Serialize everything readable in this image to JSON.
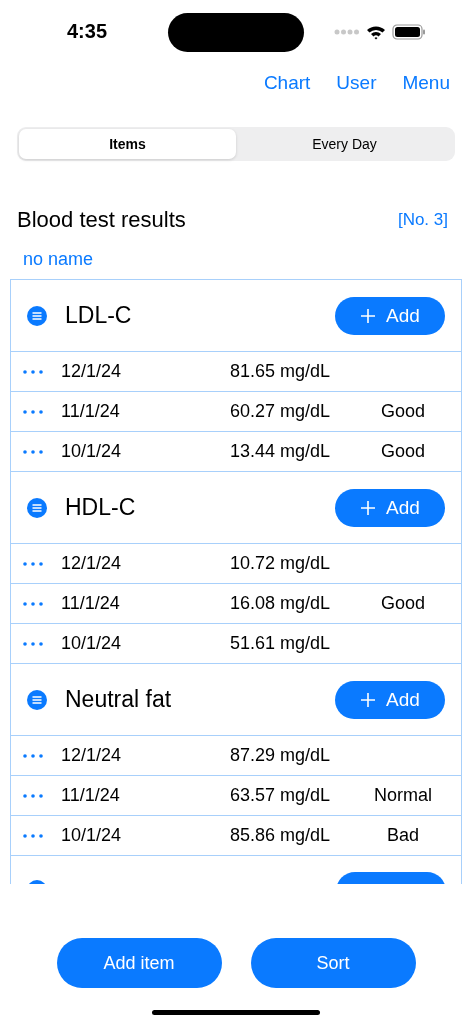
{
  "status_bar": {
    "time": "4:35"
  },
  "nav": [
    "Chart",
    "User",
    "Menu"
  ],
  "tabs": [
    {
      "label": "Items",
      "selected": true
    },
    {
      "label": "Every Day",
      "selected": false
    }
  ],
  "title": "Blood test results",
  "record_no": "[No. 3]",
  "user_name": "no name",
  "groups": [
    {
      "kind": "full",
      "title": "LDL-C",
      "add_label": "Add",
      "rows": [
        {
          "date": "12/1/24",
          "value": "81.65 mg/dL"
        },
        {
          "date": "11/1/24",
          "value": "60.27 mg/dL",
          "rating": "Good"
        },
        {
          "date": "10/1/24",
          "value": "13.44 mg/dL",
          "rating": "Good"
        }
      ]
    },
    {
      "kind": "full",
      "title": "HDL-C",
      "add_label": "Add",
      "rows": [
        {
          "date": "12/1/24",
          "value": "10.72 mg/dL"
        },
        {
          "date": "11/1/24",
          "value": "16.08 mg/dL",
          "rating": "Good"
        },
        {
          "date": "10/1/24",
          "value": "51.61 mg/dL"
        }
      ]
    },
    {
      "kind": "full",
      "title": "Neutral fat",
      "add_label": "Add",
      "rows": [
        {
          "date": "12/1/24",
          "value": "87.29 mg/dL"
        },
        {
          "date": "11/1/24",
          "value": "63.57 mg/dL",
          "rating": "Normal"
        },
        {
          "date": "10/1/24",
          "value": "85.86 mg/dL",
          "rating": "Bad"
        }
      ]
    },
    {
      "kind": "cut"
    }
  ],
  "buttons": [
    "Add item",
    "Sort"
  ]
}
